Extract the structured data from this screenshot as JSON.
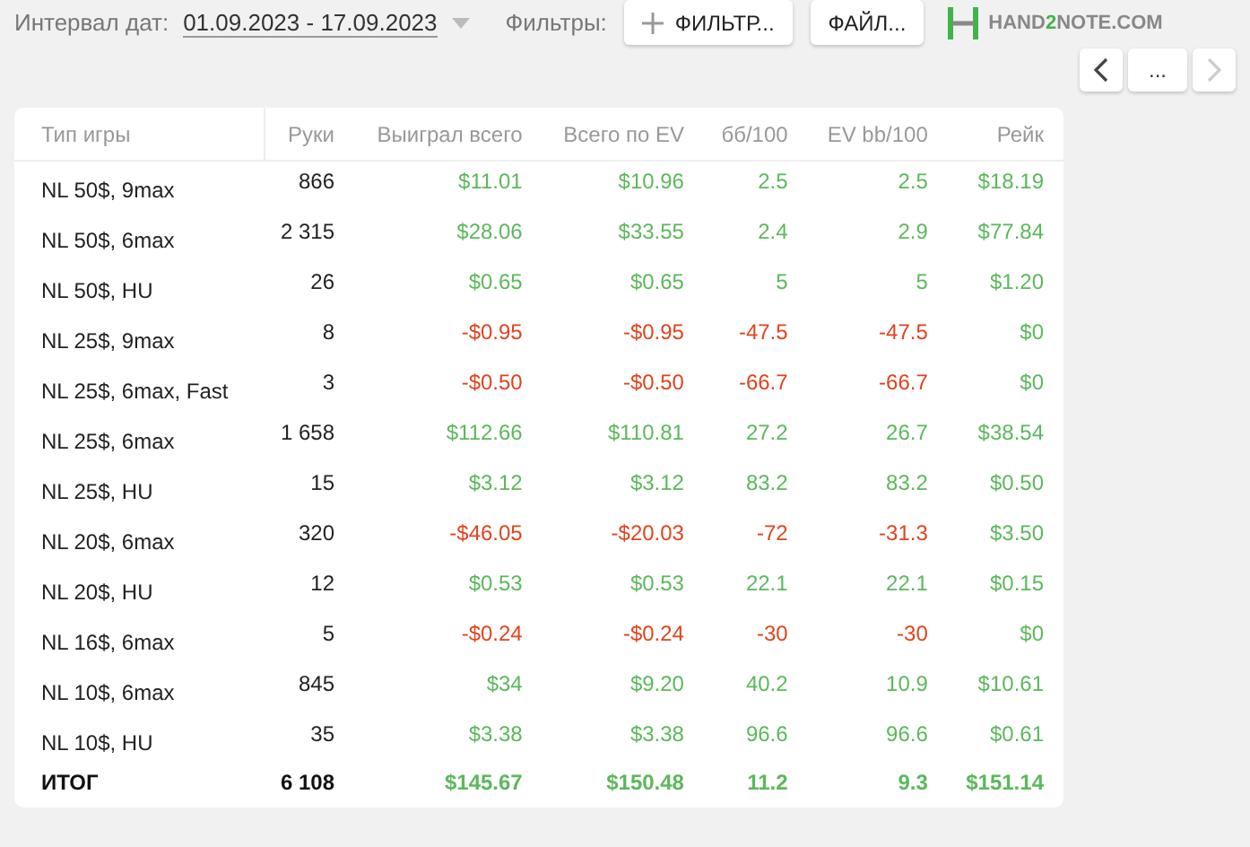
{
  "toolbar": {
    "interval_label": "Интервал дат:",
    "interval_value": "01.09.2023 - 17.09.2023",
    "filters_label": "Фильтры:",
    "filter_button": "ФИЛЬТР...",
    "file_button": "ФАЙЛ...",
    "logo": {
      "before": "HAND",
      "accent": "2",
      "after": "NOTE.COM"
    }
  },
  "nav": {
    "more": "...",
    "prev_disabled": false,
    "next_disabled": true
  },
  "table": {
    "columns": [
      "Тип игры",
      "Руки",
      "Выиграл всего",
      "Всего по EV",
      "бб/100",
      "EV bb/100",
      "Рейк"
    ],
    "rows": [
      {
        "cells": [
          {
            "text": "NL 50$, 9max"
          },
          {
            "text": "866"
          },
          {
            "text": "$11.01",
            "color": "#5cb85c"
          },
          {
            "text": "$10.96",
            "color": "#5cb85c"
          },
          {
            "text": "2.5",
            "color": "#5cb85c"
          },
          {
            "text": "2.5",
            "color": "#5cb85c"
          },
          {
            "text": "$18.19",
            "color": "#5cb85c"
          }
        ]
      },
      {
        "cells": [
          {
            "text": "NL 50$, 6max"
          },
          {
            "text": "2 315"
          },
          {
            "text": "$28.06",
            "color": "#5cb85c"
          },
          {
            "text": "$33.55",
            "color": "#5cb85c"
          },
          {
            "text": "2.4",
            "color": "#5cb85c"
          },
          {
            "text": "2.9",
            "color": "#5cb85c"
          },
          {
            "text": "$77.84",
            "color": "#5cb85c"
          }
        ]
      },
      {
        "cells": [
          {
            "text": "NL 50$, HU"
          },
          {
            "text": "26"
          },
          {
            "text": "$0.65",
            "color": "#5cb85c"
          },
          {
            "text": "$0.65",
            "color": "#5cb85c"
          },
          {
            "text": "5",
            "color": "#5cb85c"
          },
          {
            "text": "5",
            "color": "#5cb85c"
          },
          {
            "text": "$1.20",
            "color": "#5cb85c"
          }
        ]
      },
      {
        "cells": [
          {
            "text": "NL 25$, 9max"
          },
          {
            "text": "8"
          },
          {
            "text": "-$0.95",
            "color": "#e2431e"
          },
          {
            "text": "-$0.95",
            "color": "#e2431e"
          },
          {
            "text": "-47.5",
            "color": "#e2431e"
          },
          {
            "text": "-47.5",
            "color": "#e2431e"
          },
          {
            "text": "$0",
            "color": "#5cb85c"
          }
        ]
      },
      {
        "cells": [
          {
            "text": "NL 25$, 6max, Fast"
          },
          {
            "text": "3"
          },
          {
            "text": "-$0.50",
            "color": "#e2431e"
          },
          {
            "text": "-$0.50",
            "color": "#e2431e"
          },
          {
            "text": "-66.7",
            "color": "#e2431e"
          },
          {
            "text": "-66.7",
            "color": "#e2431e"
          },
          {
            "text": "$0",
            "color": "#5cb85c"
          }
        ]
      },
      {
        "cells": [
          {
            "text": "NL 25$, 6max"
          },
          {
            "text": "1 658"
          },
          {
            "text": "$112.66",
            "color": "#5cb85c"
          },
          {
            "text": "$110.81",
            "color": "#5cb85c"
          },
          {
            "text": "27.2",
            "color": "#5cb85c"
          },
          {
            "text": "26.7",
            "color": "#5cb85c"
          },
          {
            "text": "$38.54",
            "color": "#5cb85c"
          }
        ]
      },
      {
        "cells": [
          {
            "text": "NL 25$, HU"
          },
          {
            "text": "15"
          },
          {
            "text": "$3.12",
            "color": "#5cb85c"
          },
          {
            "text": "$3.12",
            "color": "#5cb85c"
          },
          {
            "text": "83.2",
            "color": "#5cb85c"
          },
          {
            "text": "83.2",
            "color": "#5cb85c"
          },
          {
            "text": "$0.50",
            "color": "#5cb85c"
          }
        ]
      },
      {
        "cells": [
          {
            "text": "NL 20$, 6max"
          },
          {
            "text": "320"
          },
          {
            "text": "-$46.05",
            "color": "#e2431e"
          },
          {
            "text": "-$20.03",
            "color": "#e2431e"
          },
          {
            "text": "-72",
            "color": "#e2431e"
          },
          {
            "text": "-31.3",
            "color": "#e2431e"
          },
          {
            "text": "$3.50",
            "color": "#5cb85c"
          }
        ]
      },
      {
        "cells": [
          {
            "text": "NL 20$, HU"
          },
          {
            "text": "12"
          },
          {
            "text": "$0.53",
            "color": "#5cb85c"
          },
          {
            "text": "$0.53",
            "color": "#5cb85c"
          },
          {
            "text": "22.1",
            "color": "#5cb85c"
          },
          {
            "text": "22.1",
            "color": "#5cb85c"
          },
          {
            "text": "$0.15",
            "color": "#5cb85c"
          }
        ]
      },
      {
        "cells": [
          {
            "text": "NL 16$, 6max"
          },
          {
            "text": "5"
          },
          {
            "text": "-$0.24",
            "color": "#e2431e"
          },
          {
            "text": "-$0.24",
            "color": "#e2431e"
          },
          {
            "text": "-30",
            "color": "#e2431e"
          },
          {
            "text": "-30",
            "color": "#e2431e"
          },
          {
            "text": "$0",
            "color": "#5cb85c"
          }
        ]
      },
      {
        "cells": [
          {
            "text": "NL 10$, 6max"
          },
          {
            "text": "845"
          },
          {
            "text": "$34",
            "color": "#5cb85c"
          },
          {
            "text": "$9.20",
            "color": "#5cb85c"
          },
          {
            "text": "40.2",
            "color": "#5cb85c"
          },
          {
            "text": "10.9",
            "color": "#5cb85c"
          },
          {
            "text": "$10.61",
            "color": "#5cb85c"
          }
        ]
      },
      {
        "cells": [
          {
            "text": "NL 10$, HU"
          },
          {
            "text": "35"
          },
          {
            "text": "$3.38",
            "color": "#5cb85c"
          },
          {
            "text": "$3.38",
            "color": "#5cb85c"
          },
          {
            "text": "96.6",
            "color": "#5cb85c"
          },
          {
            "text": "96.6",
            "color": "#5cb85c"
          },
          {
            "text": "$0.61",
            "color": "#5cb85c"
          }
        ]
      }
    ],
    "total": {
      "cells": [
        {
          "text": "ИТОГ"
        },
        {
          "text": "6 108"
        },
        {
          "text": "$145.67",
          "color": "#5cb85c"
        },
        {
          "text": "$150.48",
          "color": "#5cb85c"
        },
        {
          "text": "11.2",
          "color": "#5cb85c"
        },
        {
          "text": "9.3",
          "color": "#5cb85c"
        },
        {
          "text": "$151.14",
          "color": "#5cb85c"
        }
      ]
    }
  }
}
